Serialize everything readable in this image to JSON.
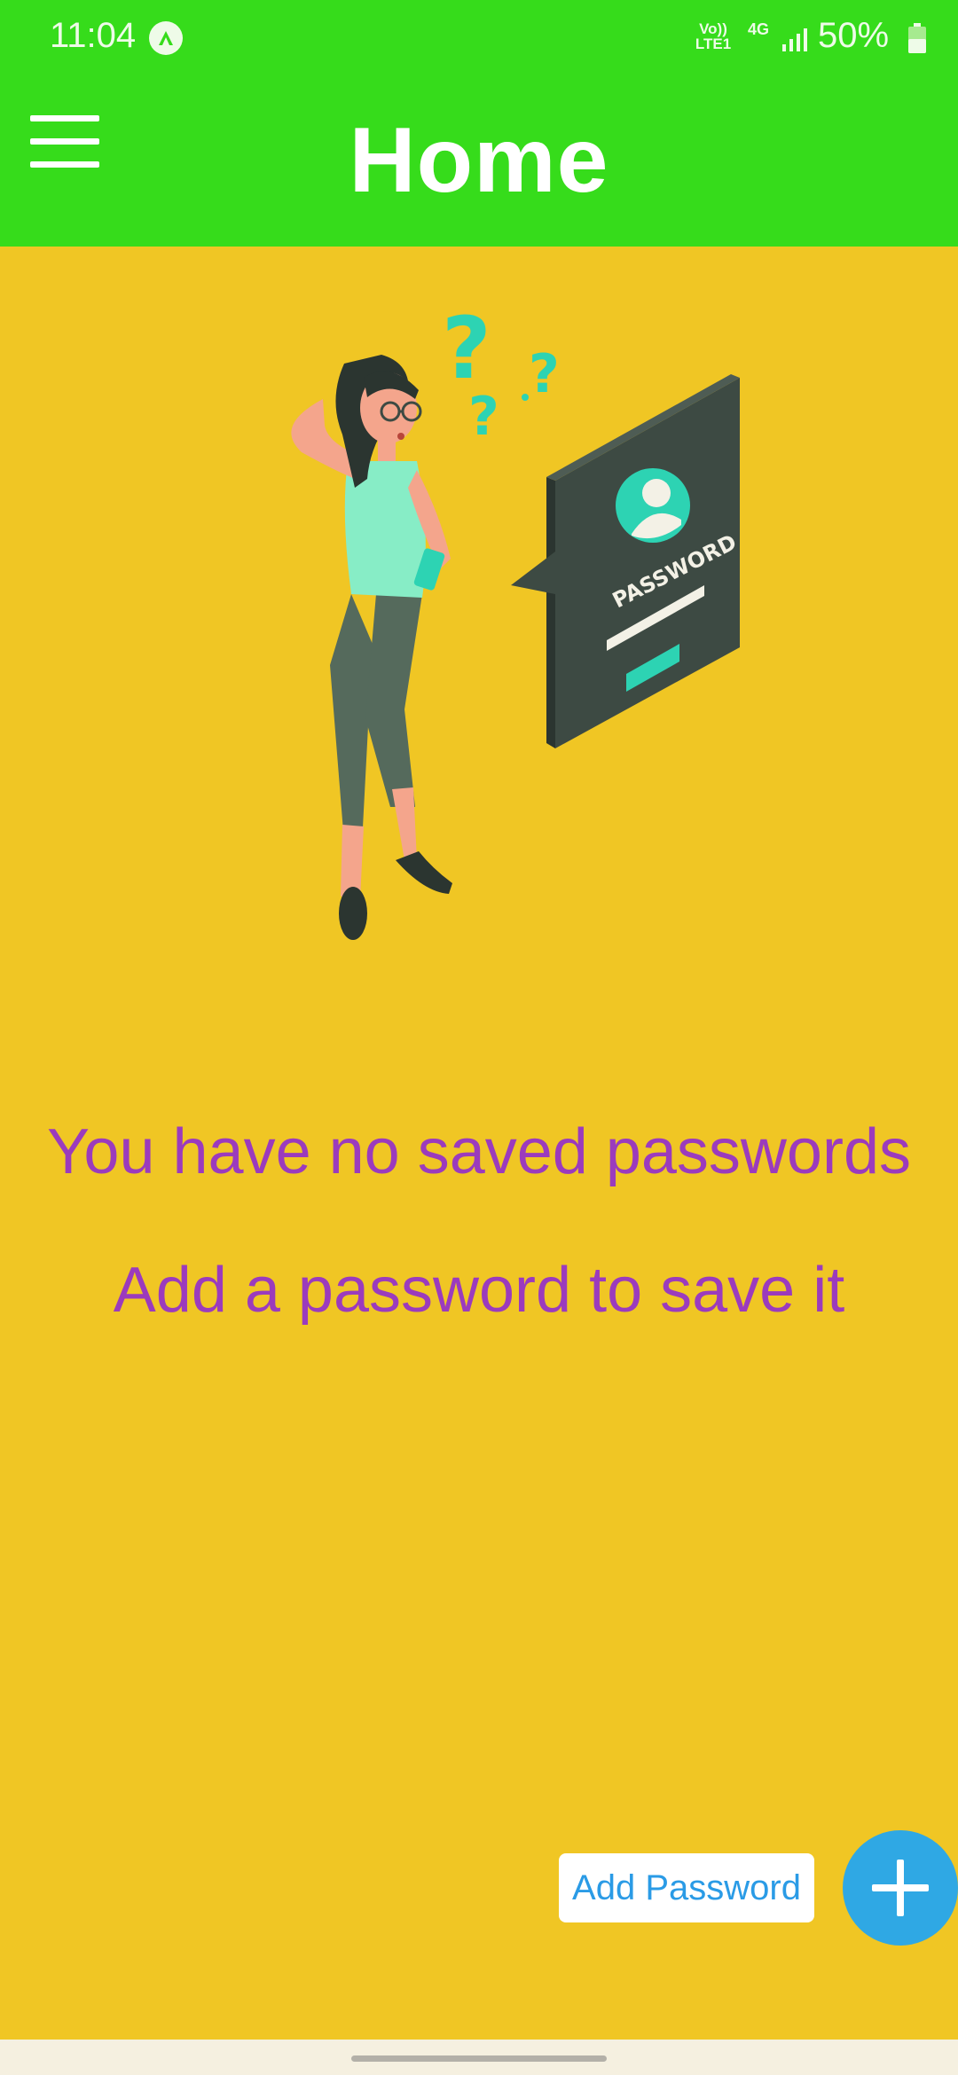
{
  "status_bar": {
    "time": "11:04",
    "network_lte": "Vo)) LTE1",
    "network_4g": "4G",
    "battery_percent": "50%",
    "battery_level": 0.5
  },
  "header": {
    "title": "Home",
    "menu_icon": "hamburger-menu-icon",
    "background_color": "#36dc1b"
  },
  "illustration": {
    "screen_label": "PASSWORD"
  },
  "empty_state": {
    "title": "You have no saved passwords",
    "subtitle": "Add a password to save it",
    "text_color": "#9b3bbd"
  },
  "actions": {
    "add_label": "Add Password",
    "fab_icon": "plus-icon",
    "fab_color": "#2fa8e4"
  },
  "page_background_color": "#f0c624"
}
